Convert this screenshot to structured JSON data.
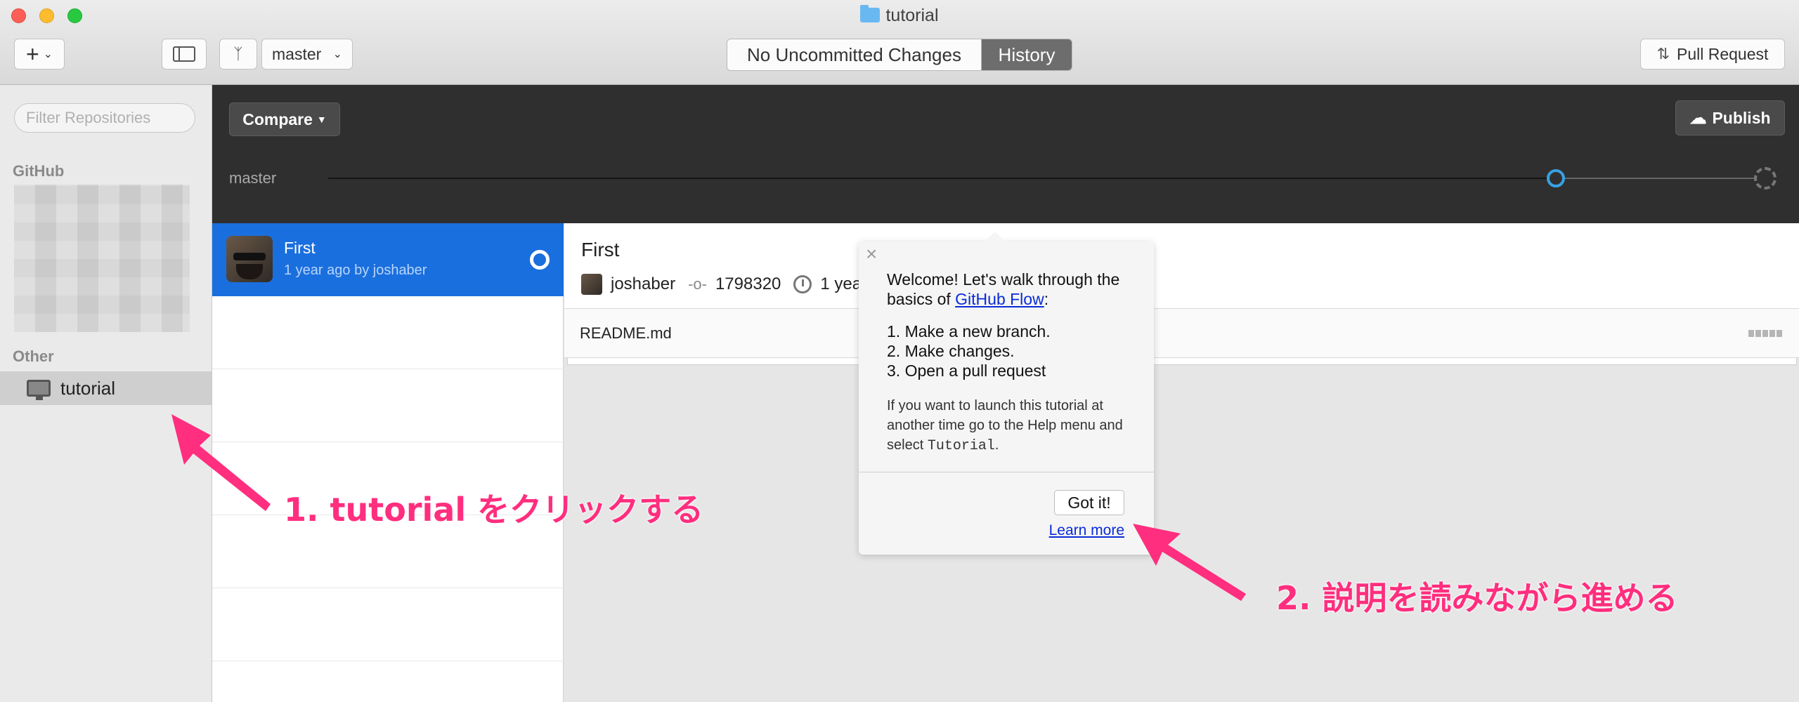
{
  "window": {
    "title": "tutorial"
  },
  "toolbar": {
    "add_label": "+",
    "branch_label": "master",
    "seg_changes": "No Uncommitted Changes",
    "seg_history": "History",
    "pull_request": "Pull Request"
  },
  "sidebar": {
    "filter_placeholder": "Filter Repositories",
    "github_header": "GitHub",
    "other_header": "Other",
    "repo_name": "tutorial"
  },
  "header": {
    "compare": "Compare",
    "publish": "Publish",
    "branch": "master"
  },
  "history": {
    "commits": [
      {
        "title": "First",
        "subtitle": "1 year ago by joshaber"
      }
    ]
  },
  "detail": {
    "title": "First",
    "author": "joshaber",
    "sha": "1798320",
    "time": "1 yea",
    "file": "README.md"
  },
  "popover": {
    "intro_1": "Welcome! Let's walk through the basics of ",
    "intro_link": "GitHub Flow",
    "intro_2": ":",
    "step_1": "1. Make a new branch.",
    "step_2": "2. Make changes.",
    "step_3": "3. Open a pull request",
    "note_1": "If you want to launch this tutorial at another time go to the Help menu and select ",
    "note_code": "Tutorial",
    "note_2": ".",
    "got_it": "Got it!",
    "learn_more": "Learn more"
  },
  "annotations": {
    "step1": "1. tutorial をクリックする",
    "step2": "2. 説明を読みながら進める",
    "color": "#ff2e7e"
  },
  "colors": {
    "selection": "#1a6fde",
    "dark_header": "#2f2f2f",
    "timeline_node": "#39a0e3"
  }
}
